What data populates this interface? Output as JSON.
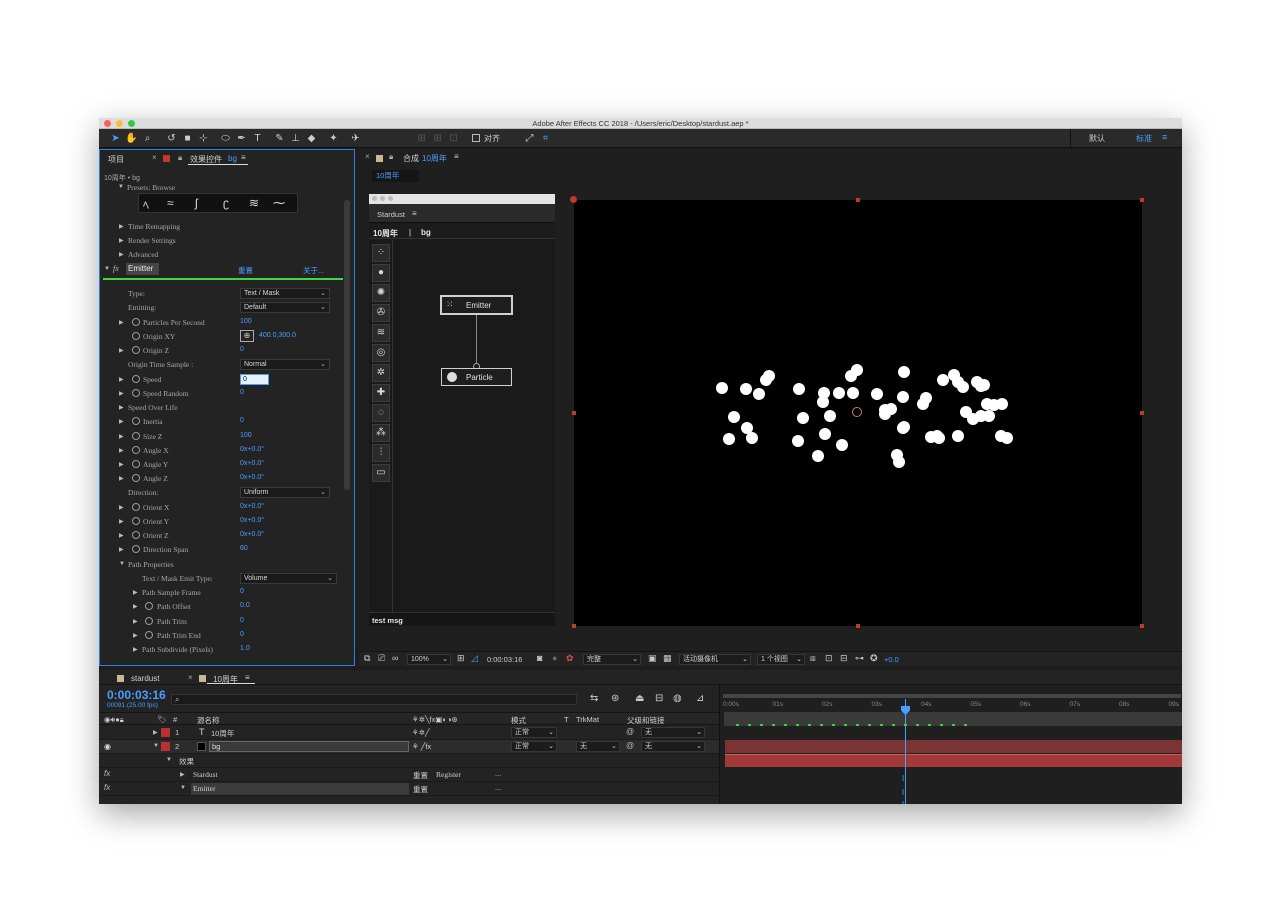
{
  "window": {
    "title": "Adobe After Effects CC 2018 - /Users/eric/Desktop/stardust.aep *"
  },
  "toolbar": {
    "align_label": "对齐",
    "workspace_default": "默认",
    "workspace_standard": "标准"
  },
  "effects_panel": {
    "project_tab": "项目",
    "effects_tab_prefix": "效果控件",
    "effects_tab_layer": "bg",
    "breadcrumb": "10周年 • bg",
    "presets_label": "Presets: Browse",
    "time_remapping": "Time Remapping",
    "render_settings": "Render Settings",
    "advanced": "Advanced",
    "emitter_label": "Emitter",
    "reset_link": "重置",
    "about_link": "关于...",
    "type_label": "Type:",
    "type_value": "Text / Mask",
    "emitting_label": "Emitting:",
    "emitting_value": "Default",
    "particles_per_second": {
      "label": "Particles Per Second",
      "value": "100"
    },
    "origin_xy": {
      "label": "Origin XY",
      "value": "400.0,300.0"
    },
    "origin_z": {
      "label": "Origin Z",
      "value": "0"
    },
    "origin_time_sample": {
      "label": "Origin Time Sample :",
      "value": "Normal"
    },
    "speed": {
      "label": "Speed",
      "value": "0"
    },
    "speed_random": {
      "label": "Speed Random",
      "value": "0"
    },
    "speed_over_life": "Speed Over Life",
    "inertia": {
      "label": "Inertia",
      "value": "0"
    },
    "size_z": {
      "label": "Size Z",
      "value": "100"
    },
    "angle_x": {
      "label": "Angle X",
      "value": "0x+0.0°"
    },
    "angle_y": {
      "label": "Angle Y",
      "value": "0x+0.0°"
    },
    "angle_z": {
      "label": "Angle Z",
      "value": "0x+0.0°"
    },
    "direction": {
      "label": "Direction:",
      "value": "Uniform"
    },
    "orient_x": {
      "label": "Orient X",
      "value": "0x+0.0°"
    },
    "orient_y": {
      "label": "Orient Y",
      "value": "0x+0.0°"
    },
    "orient_z": {
      "label": "Orient Z",
      "value": "0x+0.0°"
    },
    "direction_span": {
      "label": "Direction Span",
      "value": "60"
    },
    "path_properties": "Path Properties",
    "text_mask_emit_type": {
      "label": "Text / Mask Emit Type:",
      "value": "Volume"
    },
    "path_sample_frame": {
      "label": "Path Sample Frame",
      "value": "0"
    },
    "path_offset": {
      "label": "Path Offset",
      "value": "0.0"
    },
    "path_trim": {
      "label": "Path Trim",
      "value": "0"
    },
    "path_trim_end": {
      "label": "Path Trim End",
      "value": "0"
    },
    "path_subdivide": {
      "label": "Path Subdivide (Pixels)",
      "value": "1.0"
    }
  },
  "comp_panel": {
    "tab_prefix": "合成",
    "tab_name": "10周年",
    "sub_tab": "10周年"
  },
  "stardust": {
    "title": "Stardust",
    "breadcrumb_comp": "10周年",
    "breadcrumb_sep": "|",
    "breadcrumb_layer": "bg",
    "node_emitter": "Emitter",
    "node_particle": "Particle",
    "status": "test msg"
  },
  "viewer_bar": {
    "zoom": "100%",
    "timecode": "0:00:03:16",
    "quality": "完整",
    "camera": "活动摄像机",
    "views": "1 个视图",
    "exposure": "+0.0"
  },
  "timeline": {
    "tab_stardust": "stardust",
    "tab_comp": "10周年",
    "timecode": "0:00:03:16",
    "frame_info": "00091 (25.00 fps)",
    "col_source": "源名称",
    "col_mode": "模式",
    "col_t": "T",
    "col_trkmat": "TrkMat",
    "col_parent": "父级和链接",
    "layers": [
      {
        "num": "1",
        "type_icon": "T",
        "name": "10周年",
        "mode": "正常",
        "trkmat": "",
        "parent": "无"
      },
      {
        "num": "2",
        "type_icon": "",
        "name": "bg",
        "mode": "正常",
        "trkmat": "无",
        "parent": "无"
      }
    ],
    "effects_label": "效果",
    "fx_stardust": "Stardust",
    "fx_stardust_reset": "重置",
    "fx_stardust_register": "Register",
    "fx_stardust_more": "...",
    "fx_emitter": "Emitter",
    "fx_emitter_reset": "重置",
    "fx_emitter_more": "...",
    "ruler": [
      "0:00s",
      "01s",
      "02s",
      "03s",
      "04s",
      "05s",
      "06s",
      "07s",
      "08s",
      "09s"
    ]
  },
  "colors": {
    "accent": "#4a9eff",
    "layer_label_red": "#b8302f",
    "bar_red": "#a33a3a"
  }
}
